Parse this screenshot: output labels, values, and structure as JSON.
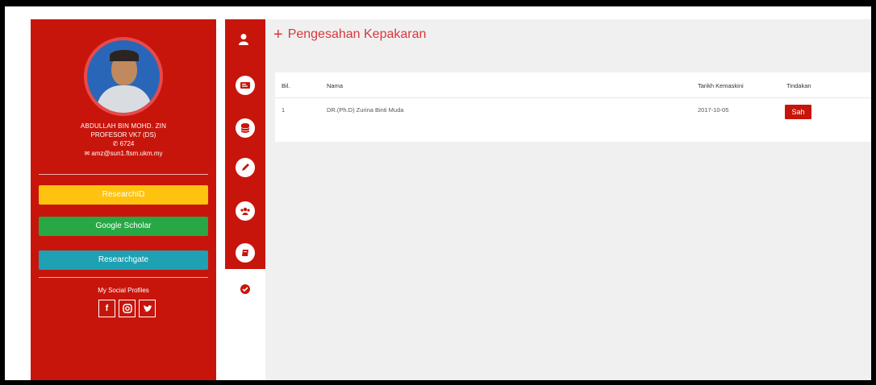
{
  "profile": {
    "name": "ABDULLAH BIN MOHD. ZIN",
    "title": "PROFESOR VK7 (DS)",
    "phone": "6724",
    "email": "amz@sun1.ftsm.ukm.my",
    "buttons": {
      "researchid": "ResearchID",
      "google_scholar": "Google Scholar",
      "researchgate": "Researchgate"
    },
    "social_label": "My Social Profiles",
    "social_icons": [
      "facebook-icon",
      "instagram-icon",
      "twitter-icon"
    ]
  },
  "sidebar_icons": [
    "user-icon",
    "list-card-icon",
    "database-icon",
    "pencil-icon",
    "group-icon",
    "book-icon",
    "check-circle-icon"
  ],
  "page": {
    "header_plus": "+",
    "title": "Pengesahan Kepakaran"
  },
  "table": {
    "headers": [
      "Bil.",
      "Nama",
      "Tarikh Kemaskini",
      "Tindakan"
    ],
    "rows": [
      {
        "bil": "1",
        "nama": "DR.(Ph.D) Zurina Binti Muda",
        "tarikh": "2017-10-05",
        "action": "Sah"
      }
    ]
  },
  "colors": {
    "brand_red": "#c8150b",
    "header_red": "#d9373b",
    "researchid_yellow": "#ffc20e",
    "scholar_green": "#27a844",
    "researchgate_teal": "#1ea1b3"
  }
}
